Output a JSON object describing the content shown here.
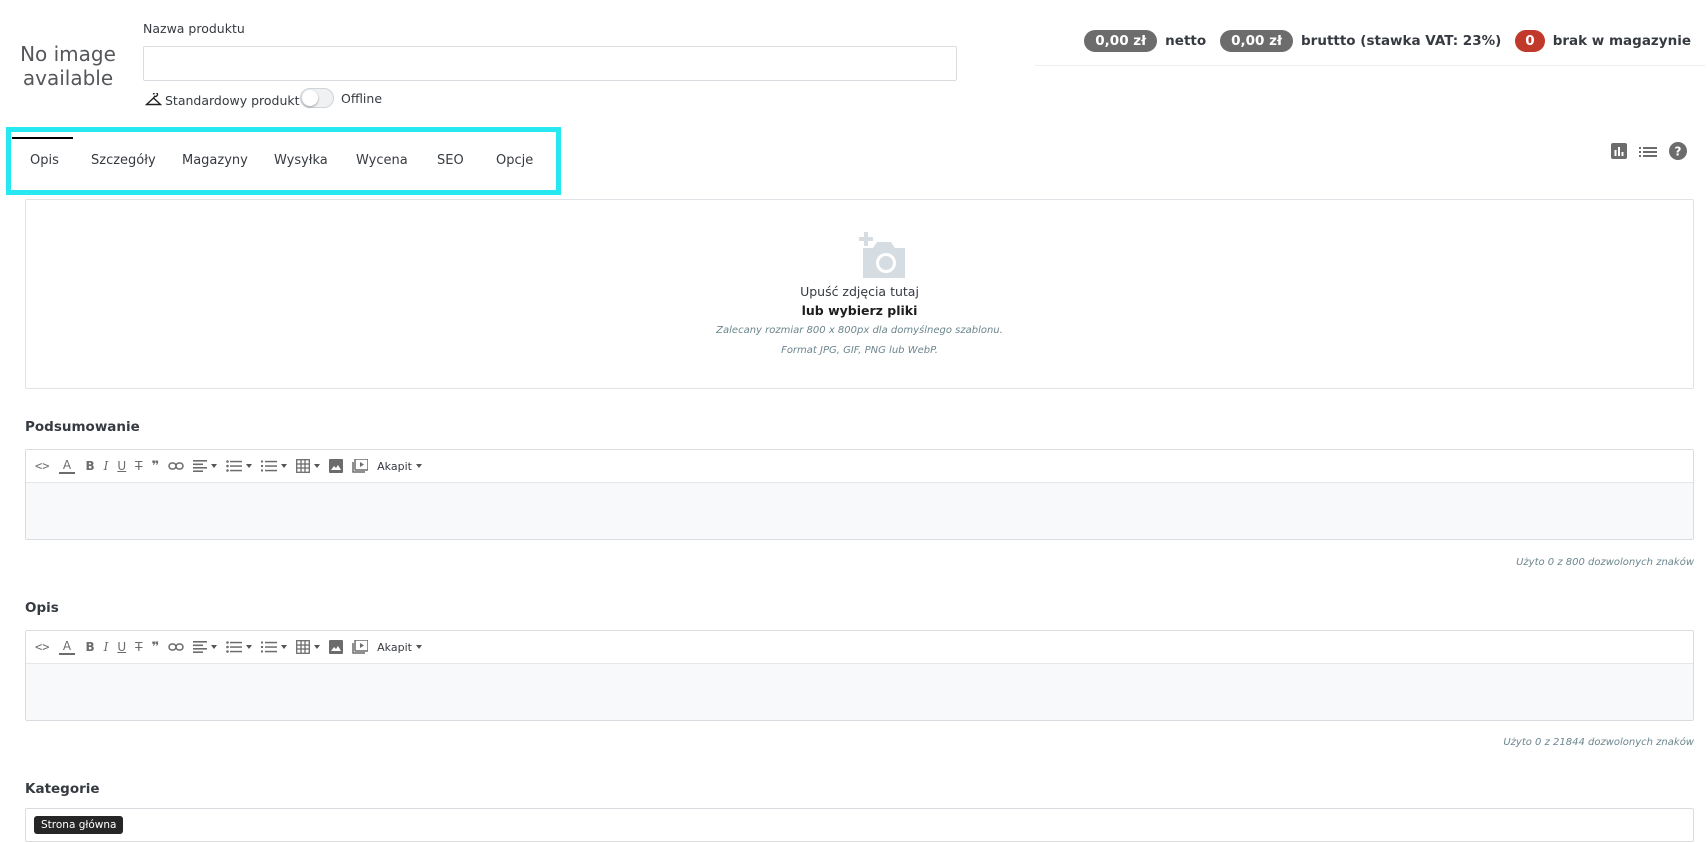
{
  "product": {
    "no_image_line1": "No image",
    "no_image_line2": "available",
    "name_label": "Nazwa produktu",
    "name_value": "",
    "type_label": "Standardowy produkt",
    "status_label": "Offline"
  },
  "prices": {
    "net_value": "0,00 zł",
    "net_label": "netto",
    "gross_value": "0,00 zł",
    "gross_label": "bruttto (stawka VAT: 23%)",
    "stock_value": "0",
    "stock_label": "brak w magazynie"
  },
  "tabs": [
    {
      "label": "Opis"
    },
    {
      "label": "Szczegóły"
    },
    {
      "label": "Magazyny"
    },
    {
      "label": "Wysyłka"
    },
    {
      "label": "Wycena"
    },
    {
      "label": "SEO"
    },
    {
      "label": "Opcje"
    }
  ],
  "tool_icons": [
    "bar-chart-icon",
    "list-icon",
    "help-icon"
  ],
  "dropzone": {
    "line1": "Upuść zdjęcia tutaj",
    "line2": "lub wybierz pliki",
    "hint1": "Zalecany rozmiar 800 x 800px dla domyślnego szablonu.",
    "hint2": "Format JPG, GIF, PNG lub WebP."
  },
  "summary": {
    "title": "Podsumowanie",
    "paragraph_label": "Akapit",
    "counter": "Użyto 0 z 800 dozwolonych znaków"
  },
  "description": {
    "title": "Opis",
    "paragraph_label": "Akapit",
    "counter": "Użyto 0 z 21844 dozwolonych znaków"
  },
  "categories": {
    "title": "Kategorie",
    "chip": "Strona główna"
  },
  "colors": {
    "highlight": "#25e8f0",
    "pill": "#6c6c6c",
    "stock_badge": "#c0392b"
  }
}
